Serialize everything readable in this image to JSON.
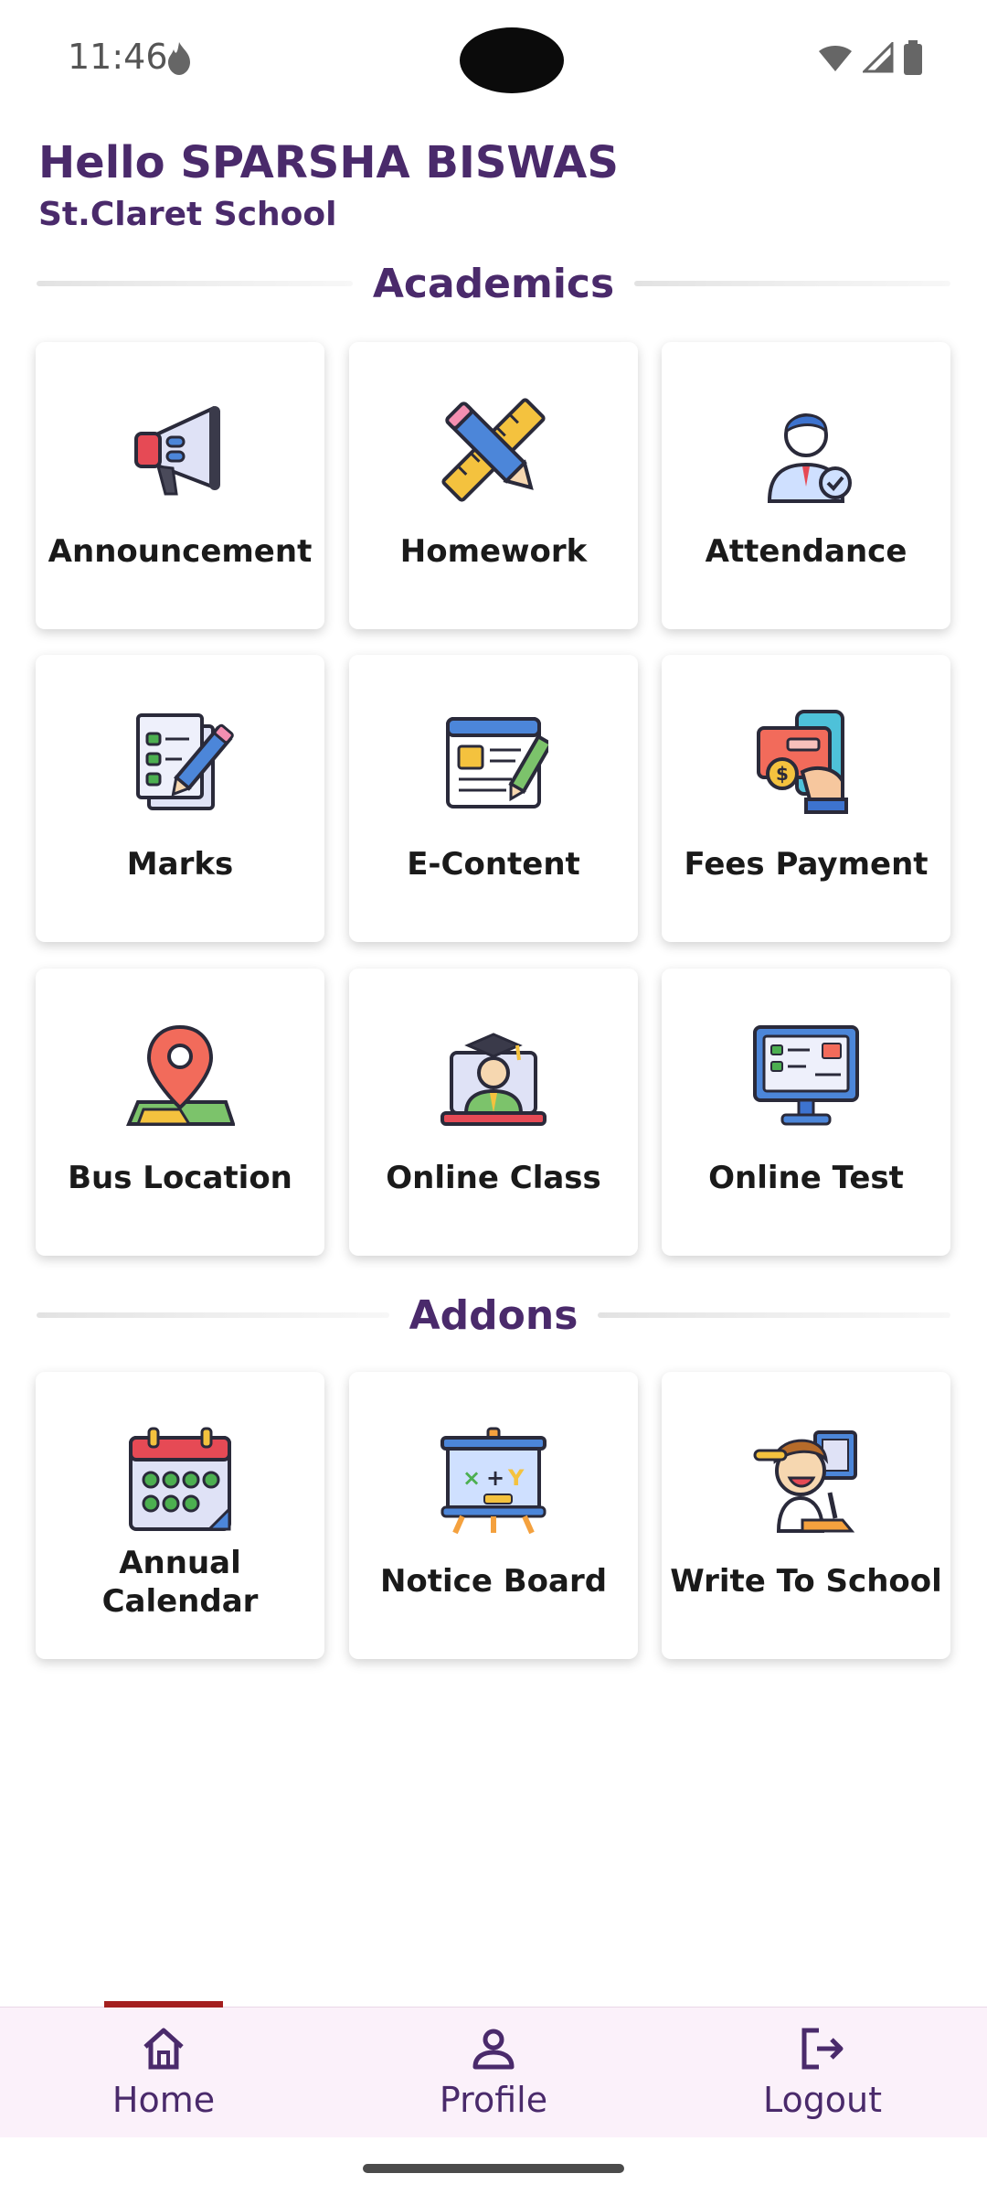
{
  "status_bar": {
    "time": "11:46"
  },
  "greeting": {
    "name": "Hello SPARSHA BISWAS",
    "school": "St.Claret School"
  },
  "sections": {
    "academics": {
      "title": "Academics",
      "tiles": [
        {
          "label": "Announcement",
          "icon": "megaphone-icon"
        },
        {
          "label": "Homework",
          "icon": "pencil-ruler-icon"
        },
        {
          "label": "Attendance",
          "icon": "person-check-icon"
        },
        {
          "label": "Marks",
          "icon": "checklist-icon"
        },
        {
          "label": "E-Content",
          "icon": "webpage-edit-icon"
        },
        {
          "label": "Fees Payment",
          "icon": "card-payment-icon"
        },
        {
          "label": "Bus Location",
          "icon": "map-pin-icon"
        },
        {
          "label": "Online Class",
          "icon": "graduate-laptop-icon"
        },
        {
          "label": "Online Test",
          "icon": "monitor-test-icon"
        }
      ]
    },
    "addons": {
      "title": "Addons",
      "tiles": [
        {
          "label": "Annual Calendar",
          "label_line1": "Annual",
          "label_line2": "Calendar",
          "icon": "calendar-icon"
        },
        {
          "label": "Notice Board",
          "icon": "board-icon"
        },
        {
          "label": "Write To School",
          "icon": "student-writing-icon"
        }
      ]
    }
  },
  "bottom_nav": {
    "items": [
      {
        "label": "Home",
        "icon": "home-icon",
        "active": true
      },
      {
        "label": "Profile",
        "icon": "profile-icon",
        "active": false
      },
      {
        "label": "Logout",
        "icon": "logout-icon",
        "active": false
      }
    ],
    "active_color": "#a41f1f",
    "text_color": "#4a2a6b",
    "background": "#fbf1fa"
  }
}
